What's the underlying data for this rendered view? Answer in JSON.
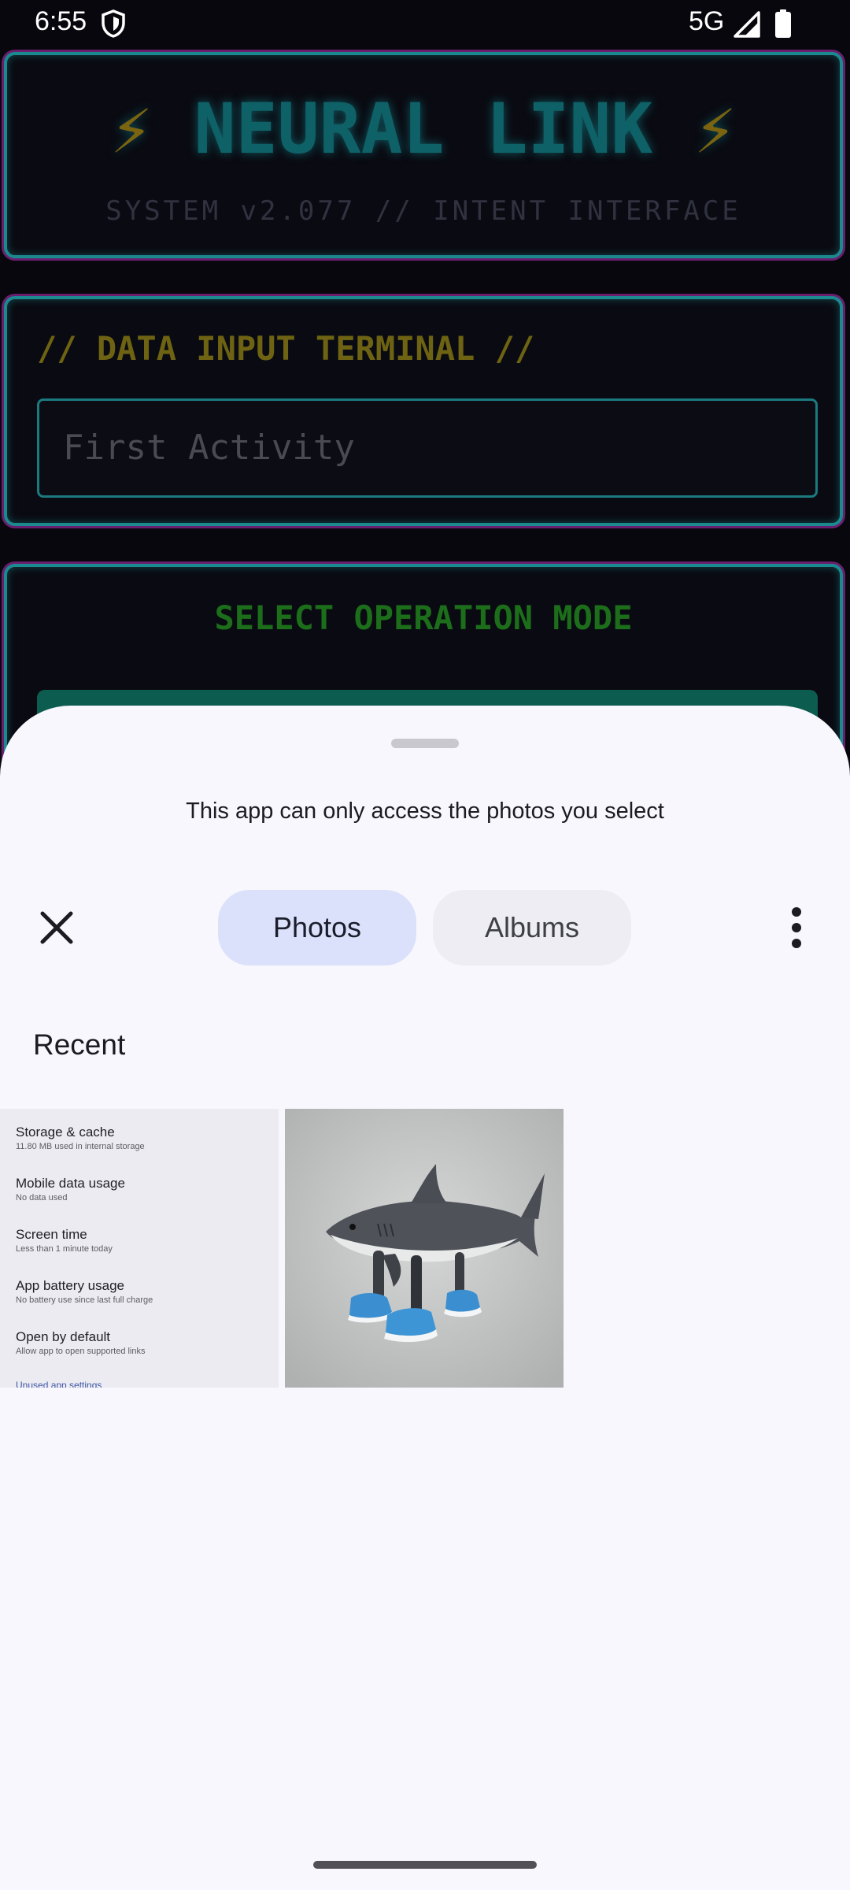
{
  "status_bar": {
    "time": "6:55",
    "network": "5G",
    "icons": [
      "shield-icon",
      "signal-icon",
      "battery-icon"
    ]
  },
  "background_app": {
    "title": "NEURAL LINK",
    "title_bolt": "⚡",
    "subtitle": "SYSTEM v2.077 // INTENT INTERFACE",
    "terminal_label": "// DATA INPUT TERMINAL //",
    "input_placeholder": "First Activity",
    "mode_label": "SELECT OPERATION MODE",
    "colors": {
      "accent_cyan": "#1b8a8f",
      "accent_magenta": "#6a1f6e",
      "mode_green": "#1c6e1a",
      "label_yellow": "#6e6312"
    }
  },
  "picker": {
    "notice": "This app can only access the photos you select",
    "tabs": [
      {
        "label": "Photos",
        "selected": true
      },
      {
        "label": "Albums",
        "selected": false
      }
    ],
    "section_title": "Recent",
    "thumbnails": [
      {
        "kind": "settings-screenshot",
        "items": [
          {
            "title": "Storage & cache",
            "subtitle": "11.80 MB used in internal storage"
          },
          {
            "title": "Mobile data usage",
            "subtitle": "No data used"
          },
          {
            "title": "Screen time",
            "subtitle": "Less than 1 minute today"
          },
          {
            "title": "App battery usage",
            "subtitle": "No battery use since last full charge"
          },
          {
            "title": "Open by default",
            "subtitle": "Allow app to open supported links"
          },
          {
            "title": "Unused app settings",
            "subtitle": ""
          }
        ]
      },
      {
        "kind": "photo-shark-toy-with-sneakers"
      }
    ],
    "colors": {
      "sheet_bg": "#f8f7fd",
      "tab_selected": "#dbe1fa",
      "tab_unselected": "#eeedf3"
    }
  }
}
